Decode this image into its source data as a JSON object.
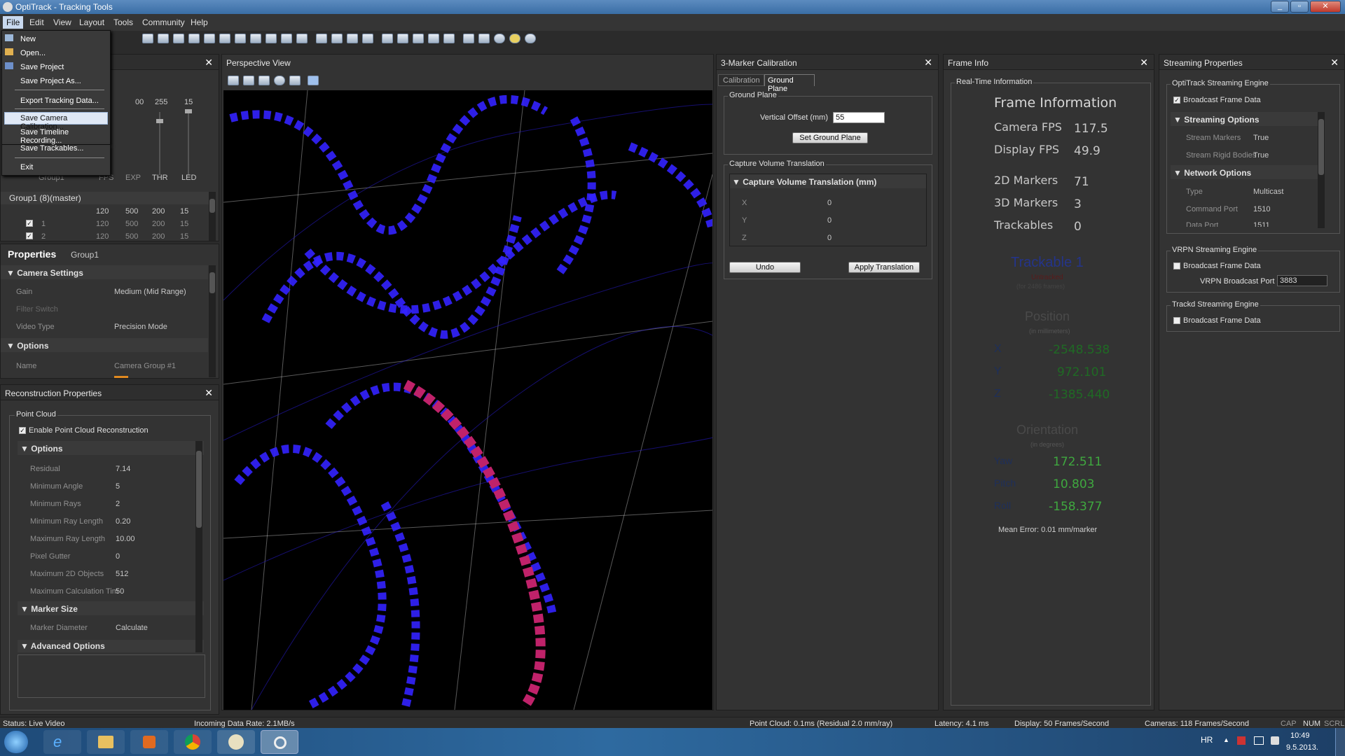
{
  "window": {
    "title": "OptiTrack - Tracking Tools"
  },
  "menu": [
    "File",
    "Edit",
    "View",
    "Layout",
    "Tools",
    "Community",
    "Help"
  ],
  "file_menu": [
    "New",
    "Open...",
    "Save Project",
    "Save Project As...",
    "Export Tracking Data...",
    "Save Camera Calibration...",
    "Save Timeline Recording...",
    "Save Trackables...",
    "Exit"
  ],
  "devices": {
    "col_headers": [
      "Group1",
      "FPS",
      "EXP",
      "THR",
      "LED"
    ],
    "slider_values": [
      "00",
      "255",
      "15"
    ],
    "group_row": {
      "label": "Group1 (8)(master)",
      "values": [
        "120",
        "500",
        "200",
        "15"
      ]
    },
    "rows": [
      {
        "id": "1",
        "values": [
          "120",
          "500",
          "200",
          "15"
        ]
      },
      {
        "id": "2",
        "values": [
          "120",
          "500",
          "200",
          "15"
        ]
      }
    ]
  },
  "properties": {
    "title": "Properties",
    "tab": "Group1",
    "camera_settings": "Camera Settings",
    "options": "Options",
    "items": [
      {
        "k": "Gain",
        "v": "Medium (Mid Range)"
      },
      {
        "k": "Filter Switch",
        "v": ""
      },
      {
        "k": "Video Type",
        "v": "Precision Mode"
      }
    ],
    "name_key": "Name",
    "name_val": "Camera Group #1"
  },
  "recon": {
    "title": "Reconstruction Properties",
    "group": "Point Cloud",
    "enable": "Enable Point Cloud Reconstruction",
    "options": "Options",
    "items": [
      {
        "k": "Residual",
        "v": "7.14"
      },
      {
        "k": "Minimum Angle",
        "v": "5"
      },
      {
        "k": "Minimum Rays",
        "v": "2"
      },
      {
        "k": "Minimum Ray Length",
        "v": "0.20"
      },
      {
        "k": "Maximum Ray Length",
        "v": "10.00"
      },
      {
        "k": "Pixel Gutter",
        "v": "0"
      },
      {
        "k": "Maximum 2D Objects",
        "v": "512"
      },
      {
        "k": "Maximum Calculation Tim",
        "v": "50"
      }
    ],
    "marker_size": "Marker Size",
    "marker_diameter": "Marker Diameter",
    "marker_diameter_val": "Calculate",
    "advanced": "Advanced Options"
  },
  "perspective": {
    "title": "Perspective View"
  },
  "calib": {
    "title": "3-Marker Calibration",
    "tabs": [
      "Calibration",
      "Ground Plane"
    ],
    "ground_plane": "Ground Plane",
    "vertical_offset": "Vertical Offset (mm)",
    "vertical_offset_val": "55",
    "set_btn": "Set Ground Plane",
    "cvt_group": "Capture Volume Translation",
    "cvt_header": "Capture Volume Translation (mm)",
    "axes": [
      {
        "k": "X",
        "v": "0"
      },
      {
        "k": "Y",
        "v": "0"
      },
      {
        "k": "Z",
        "v": "0"
      }
    ],
    "undo": "Undo",
    "apply": "Apply Translation"
  },
  "frame": {
    "title": "Frame Info",
    "group": "Real-Time Information",
    "heading": "Frame Information",
    "stats": [
      {
        "k": "Camera FPS",
        "v": "117.5"
      },
      {
        "k": "Display FPS",
        "v": "49.9"
      },
      {
        "k": "2D Markers",
        "v": "71"
      },
      {
        "k": "3D Markers",
        "v": "3"
      },
      {
        "k": "Trackables",
        "v": "0"
      }
    ],
    "trackable": "Trackable 1",
    "untracked": "Untracked",
    "frames": "(for 2486 frames)",
    "position": "Position",
    "pos_unit": "(in millimeters)",
    "pos": [
      {
        "k": "X",
        "v": "-2548.538"
      },
      {
        "k": "Y",
        "v": "972.101"
      },
      {
        "k": "Z",
        "v": "-1385.440"
      }
    ],
    "orientation": "Orientation",
    "ori_unit": "(in degrees)",
    "ori": [
      {
        "k": "Yaw",
        "v": "172.511"
      },
      {
        "k": "Pitch",
        "v": "10.803"
      },
      {
        "k": "Roll",
        "v": "-158.377"
      }
    ],
    "mean_error": "Mean Error: 0.01 mm/marker"
  },
  "stream": {
    "title": "Streaming Properties",
    "opti": "OptiTrack Streaming Engine",
    "broadcast": "Broadcast Frame Data",
    "streaming_options": "Streaming Options",
    "so_items": [
      {
        "k": "Stream Markers",
        "v": "True"
      },
      {
        "k": "Stream Rigid Bodies",
        "v": "True"
      }
    ],
    "network_options": "Network Options",
    "no_items": [
      {
        "k": "Type",
        "v": "Multicast"
      },
      {
        "k": "Command Port",
        "v": "1510"
      },
      {
        "k": "Data Port",
        "v": "1511"
      }
    ],
    "vrpn": "VRPN Streaming Engine",
    "vrpn_port_label": "VRPN Broadcast Port",
    "vrpn_port": "3883",
    "trackd": "Trackd Streaming Engine"
  },
  "status": {
    "live": "Status: Live Video",
    "rate": "Incoming Data Rate: 2.1MB/s",
    "pc": "Point Cloud: 0.1ms (Residual 2.0 mm/ray)",
    "latency": "Latency: 4.1 ms",
    "display": "Display: 50 Frames/Second",
    "cameras": "Cameras: 118 Frames/Second",
    "cap": "CAP",
    "num": "NUM",
    "scrl": "SCRL"
  },
  "tray": {
    "lang": "HR",
    "time": "10:49",
    "date": "9.5.2013."
  },
  "colors": {
    "accent": "#3fa83f",
    "viewport": "#000000",
    "marker": "#2b1ee0"
  }
}
